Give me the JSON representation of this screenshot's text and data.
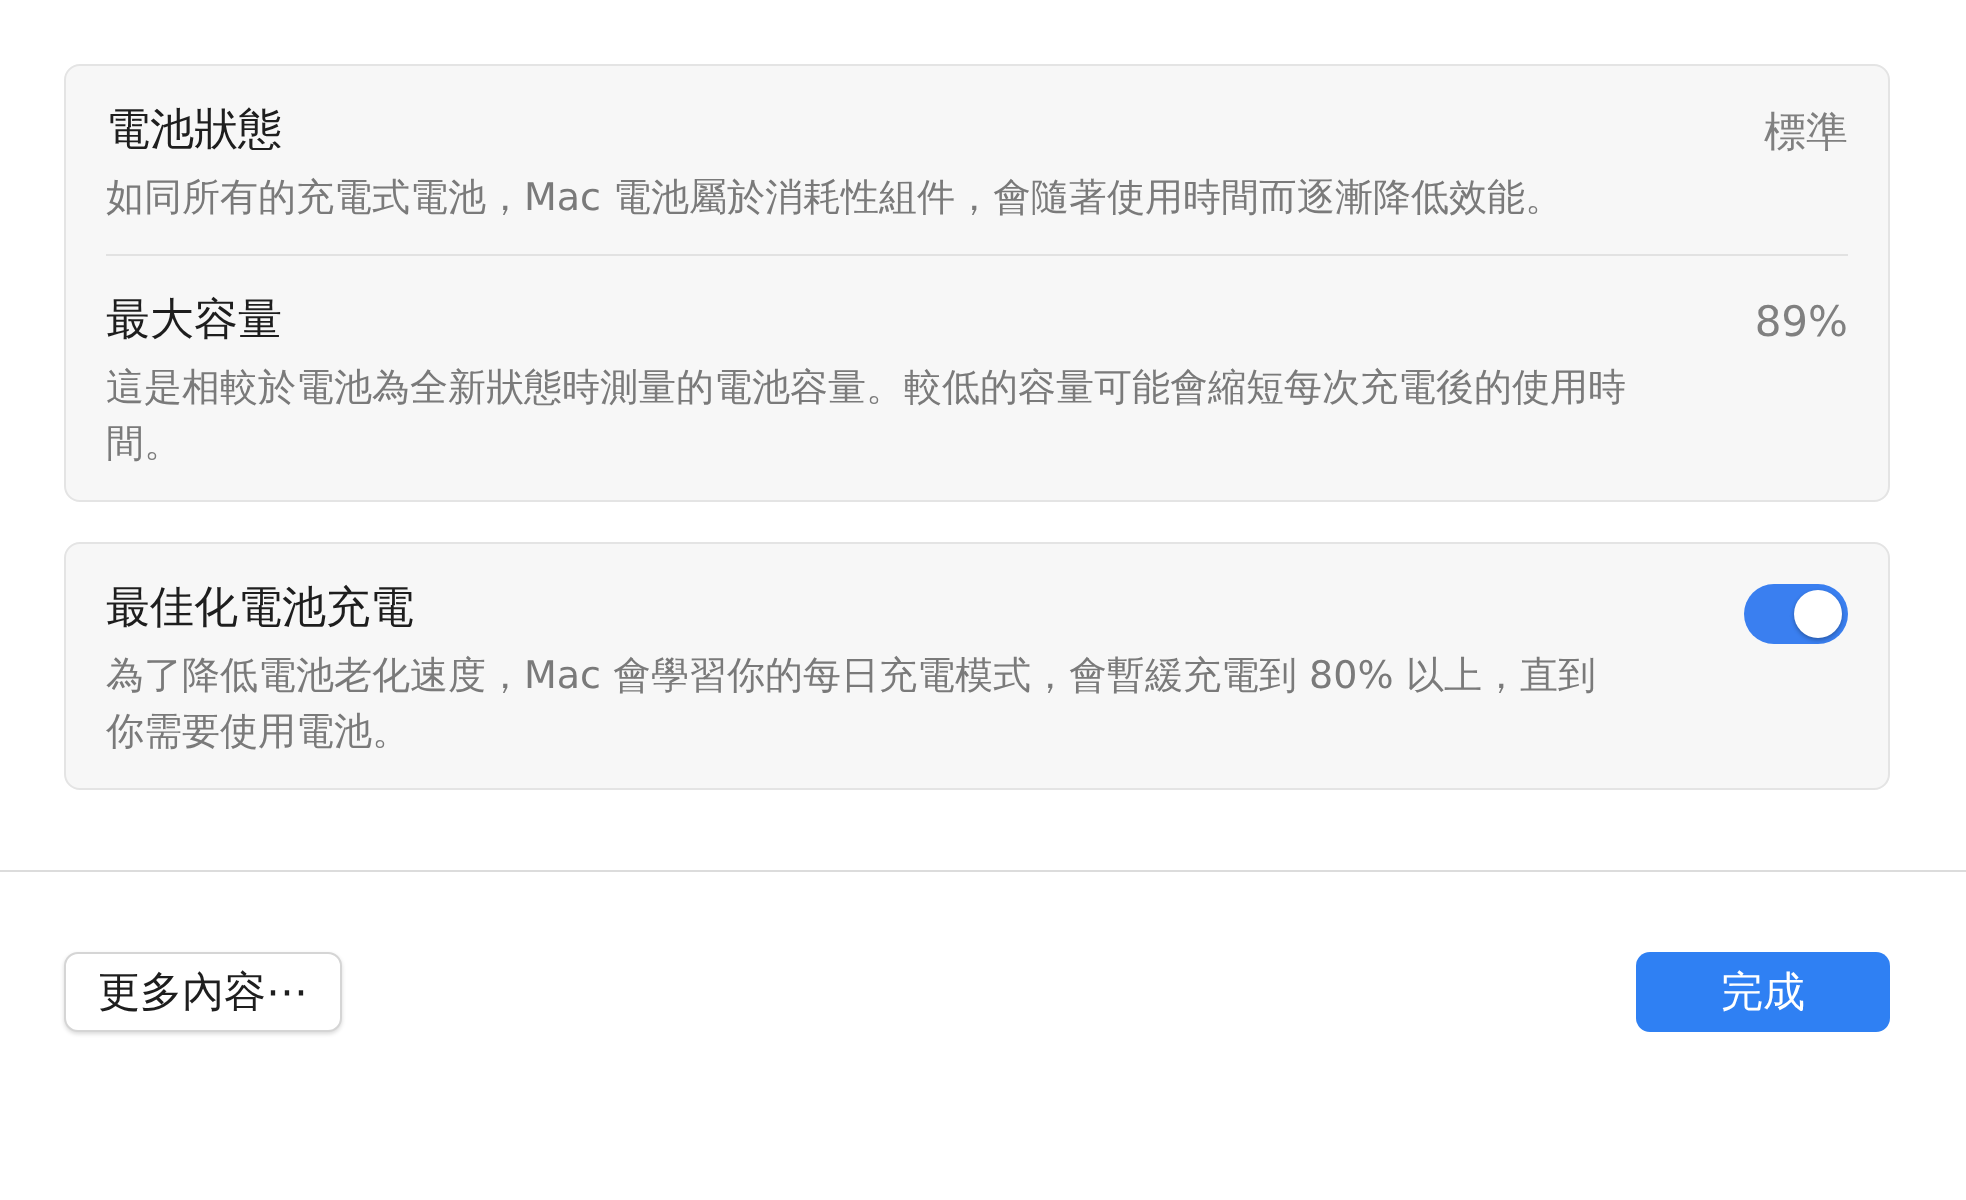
{
  "sections": [
    {
      "rows": [
        {
          "kind": "value",
          "title": "電池狀態",
          "description": "如同所有的充電式電池，Mac 電池屬於消耗性組件，會隨著使用時間而逐漸降低效能。",
          "value": "標準"
        },
        {
          "kind": "value",
          "title": "最大容量",
          "description": "這是相較於電池為全新狀態時測量的電池容量。較低的容量可能會縮短每次充電後的使用時間。",
          "value": "89%"
        }
      ]
    },
    {
      "rows": [
        {
          "kind": "toggle",
          "title": "最佳化電池充電",
          "description": "為了降低電池老化速度，Mac 會學習你的每日充電模式，會暫緩充電到 80% 以上，直到你需要使用電池。",
          "on": true
        }
      ]
    }
  ],
  "buttons": [
    {
      "label": "更多內容⋯",
      "kind": "secondary"
    },
    {
      "label": "完成",
      "kind": "primary"
    }
  ]
}
